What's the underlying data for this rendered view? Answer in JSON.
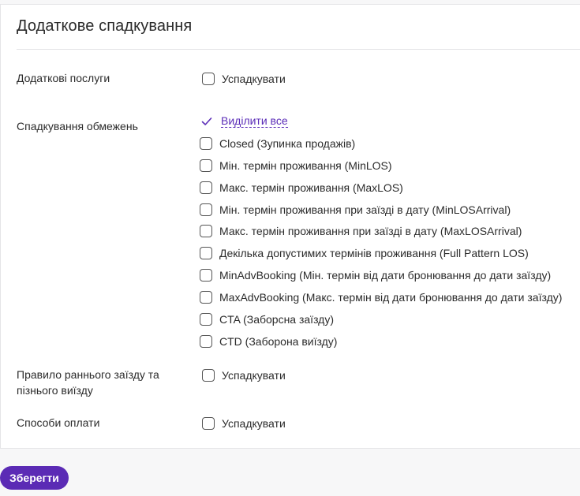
{
  "section": {
    "title": "Додаткове спадкування"
  },
  "rows": {
    "extra_services": {
      "label": "Додаткові послуги",
      "checkbox_label": "Успадкувати"
    },
    "restrictions": {
      "label": "Спадкування обмежень",
      "select_all": "Виділити все",
      "options": [
        "Closed (Зупинка продажів)",
        "Мін. термін проживання (MinLOS)",
        "Макс. термін проживання (MaxLOS)",
        "Мін. термін проживання при заїзді в дату (MinLOSArrival)",
        "Макс. термін проживання при заїзді в дату (MaxLOSArrival)",
        "Декілька допустимих термінів проживання (Full Pattern LOS)",
        "MinAdvBooking (Мін. термін від дати бронювання до дати заїзду)",
        "MaxAdvBooking (Макс. термін від дати бронювання до дати заїзду)",
        "CTA (Заборсна заїзду)",
        "CTD (Заборона виїзду)"
      ]
    },
    "checkin_rule": {
      "label": "Правило раннього заїзду та пізнього виїзду",
      "checkbox_label": "Успадкувати"
    },
    "payment_methods": {
      "label": "Способи оплати",
      "checkbox_label": "Успадкувати"
    }
  },
  "actions": {
    "save_label": "Зберегти"
  },
  "colors": {
    "accent": "#5b2bb5",
    "link": "#5b2db8"
  },
  "icons": {
    "select_all": "checkmark-icon"
  }
}
